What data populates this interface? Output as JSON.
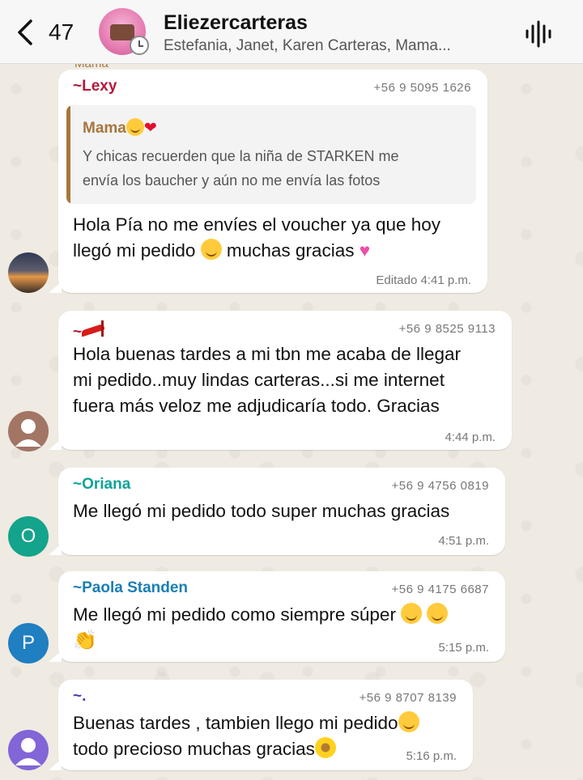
{
  "header": {
    "back_count": "47",
    "group_name": "Eliezercarteras",
    "members": "Estefania, Janet, Karen Carteras, Mama..."
  },
  "peek_text": "Mama",
  "messages": [
    {
      "sender": "~Lexy",
      "sender_color": "#b5183a",
      "phone": "+56 9 5095 1626",
      "quote": {
        "name": "Mama",
        "line1": "Y chicas recuerden que la niña de STARKEN me",
        "line2": "envía los baucher y aún no me envía las fotos"
      },
      "line1": "Hola Pía no me envíes el voucher ya que hoy",
      "line2a": "llegó mi pedido",
      "line2b": "muchas gracias",
      "time": "Editado 4:41 p.m."
    },
    {
      "sender": "~",
      "sender_color": "#b5183a",
      "phone": "+56 9 8525 9113",
      "line1": "Hola buenas tardes a mi tbn me acaba de llegar",
      "line2": "mi pedido..muy lindas carteras...si me internet",
      "line3": "fuera más veloz me adjudicaría todo. Gracias",
      "time": "4:44 p.m."
    },
    {
      "sender": "~Oriana",
      "sender_color": "#11a398",
      "phone": "+56 9 4756 0819",
      "avatar_letter": "O",
      "avatar_color": "#14a38b",
      "line1": "Me llegó mi pedido todo super muchas gracias",
      "time": "4:51 p.m."
    },
    {
      "sender": "~Paola Standen",
      "sender_color": "#1a7fb3",
      "phone": "+56 9 4175 6687",
      "avatar_letter": "P",
      "avatar_color": "#1f7fc0",
      "line1": "Me llegó mi pedido como siempre súper",
      "time": "5:15 p.m."
    },
    {
      "sender": "~.",
      "sender_color": "#4a3fb0",
      "phone": "+56 9 8707 8139",
      "line1": "Buenas tardes , tambien llego mi pedido",
      "line2": "todo precioso muchas gracias",
      "time": "5:16 p.m."
    }
  ]
}
